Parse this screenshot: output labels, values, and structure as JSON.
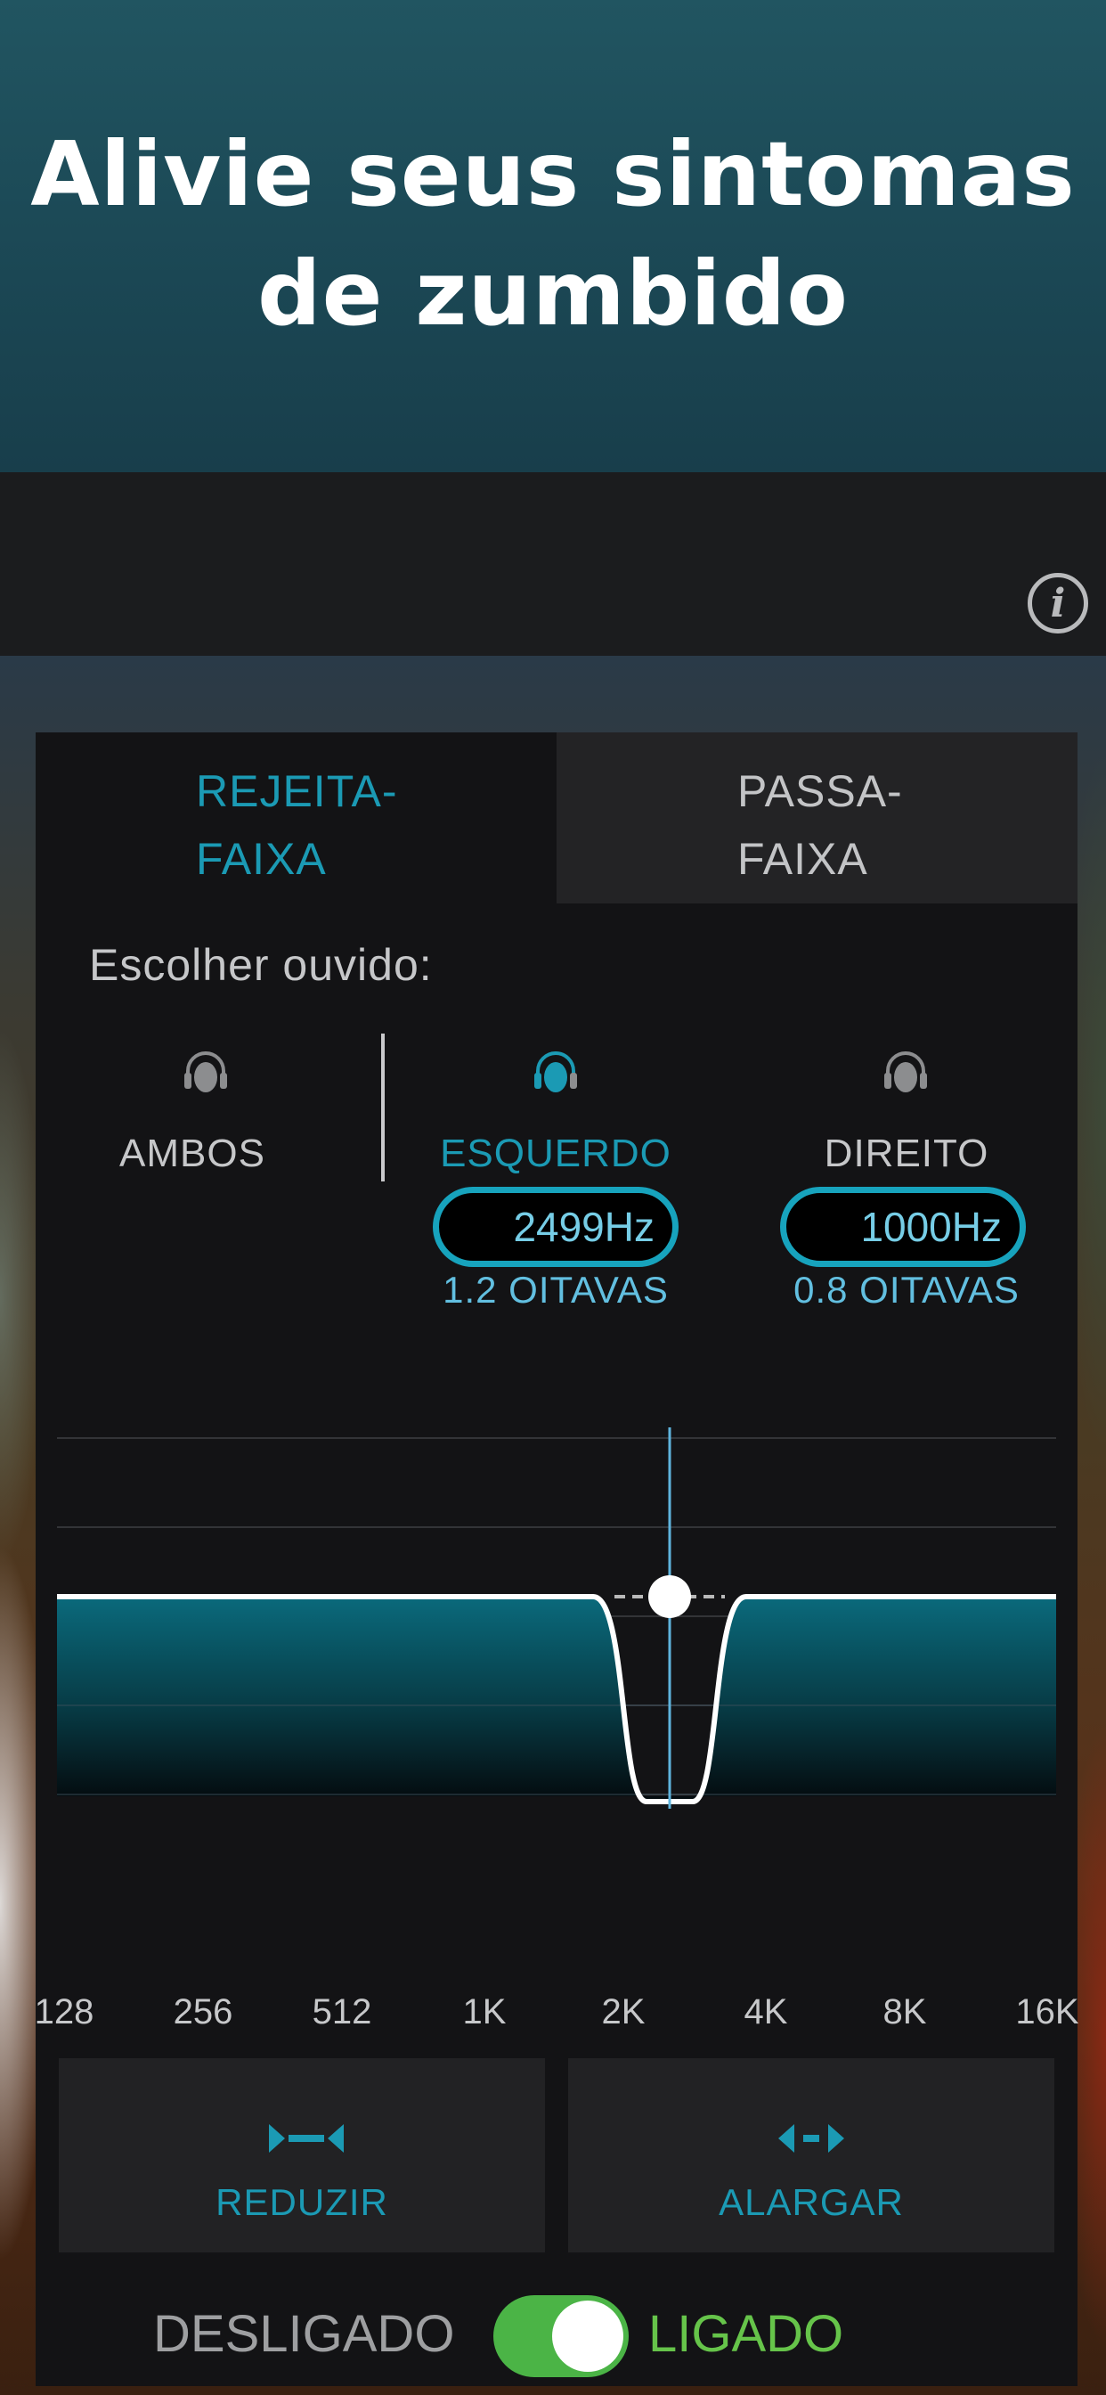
{
  "banner": {
    "line1": "Alivie seus sintomas",
    "line2": "de zumbido"
  },
  "topbar": {
    "info_glyph": "i"
  },
  "tabs": {
    "notch": {
      "line1": "REJEITA-",
      "line2": "FAIXA",
      "active": true
    },
    "bandpass": {
      "line1": "PASSA-",
      "line2": "FAIXA",
      "active": false
    }
  },
  "ear_select": {
    "label": "Escolher ouvido:",
    "both": "AMBOS",
    "left": "ESQUERDO",
    "right": "DIREITO",
    "selected": "left"
  },
  "left_ear": {
    "freq": "2499Hz",
    "octaves": "1.2 OITAVAS"
  },
  "right_ear": {
    "freq": "1000Hz",
    "octaves": "0.8 OITAVAS"
  },
  "graph": {
    "x_ticks": [
      "128",
      "256",
      "512",
      "1K",
      "2K",
      "4K",
      "8K",
      "16K"
    ],
    "center_freq_hz": 2499,
    "width_octaves": 1.2
  },
  "controls": {
    "reduce": "REDUZIR",
    "widen": "ALARGAR"
  },
  "power": {
    "off": "DESLIGADO",
    "on": "LIGADO",
    "state": true
  },
  "colors": {
    "accent": "#1b9ab4",
    "on": "#66c44a",
    "teal_fill": "#0a6a7c"
  }
}
